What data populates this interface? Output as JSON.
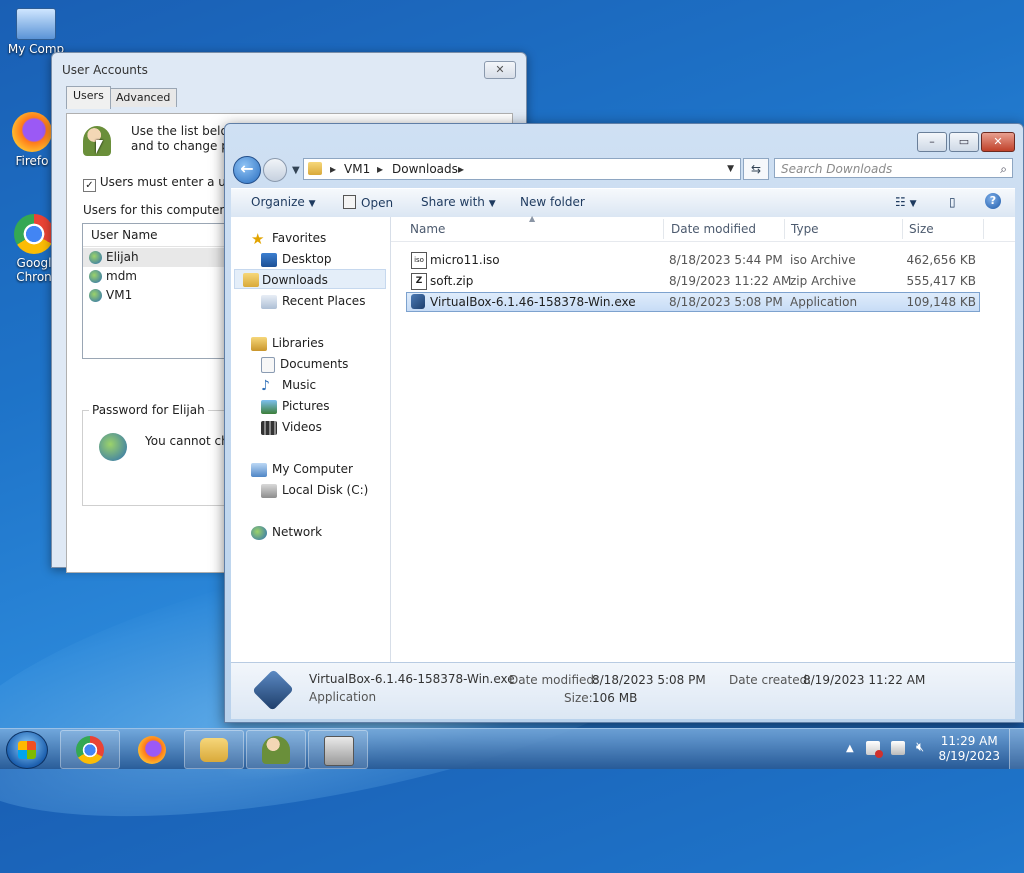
{
  "desktop": {
    "icons": [
      {
        "label": "My Comp",
        "icon": "computer-icon"
      },
      {
        "label": "Firefo",
        "icon": "firefox-icon"
      },
      {
        "label": "Googl",
        "label2": "Chron",
        "icon": "chrome-icon"
      }
    ]
  },
  "user_accounts": {
    "title": "User Accounts",
    "close_glyph": "✕",
    "tabs": [
      "Users",
      "Advanced"
    ],
    "intro_line1": "Use the list below",
    "intro_line2": "and to change pa",
    "checkbox_label": "Users must enter a user n",
    "users_label": "Users for this computer:",
    "column_username": "User Name",
    "users": [
      "Elijah",
      "mdm",
      "VM1"
    ],
    "password_group": "Password for Elijah",
    "password_text": "You cannot cha"
  },
  "explorer": {
    "breadcrumb": [
      "VM1",
      "Downloads"
    ],
    "search_placeholder": "Search Downloads",
    "toolbar": {
      "organize": "Organize",
      "open": "Open",
      "share_with": "Share with",
      "new_folder": "New folder"
    },
    "nav": {
      "favorites": "Favorites",
      "desktop": "Desktop",
      "downloads": "Downloads",
      "recent_places": "Recent Places",
      "libraries": "Libraries",
      "documents": "Documents",
      "music": "Music",
      "pictures": "Pictures",
      "videos": "Videos",
      "my_computer": "My Computer",
      "local_disk": "Local Disk (C:)",
      "network": "Network"
    },
    "columns": {
      "name": "Name",
      "date": "Date modified",
      "type": "Type",
      "size": "Size"
    },
    "files": [
      {
        "name": "micro11.iso",
        "date": "8/18/2023 5:44 PM",
        "type": "iso Archive",
        "size": "462,656 KB"
      },
      {
        "name": "soft.zip",
        "date": "8/19/2023 11:22 AM",
        "type": "zip Archive",
        "size": "555,417 KB"
      },
      {
        "name": "VirtualBox-6.1.46-158378-Win.exe",
        "date": "8/18/2023 5:08 PM",
        "type": "Application",
        "size": "109,148 KB"
      }
    ],
    "details": {
      "filename": "VirtualBox-6.1.46-158378-Win.exe",
      "filetype": "Application",
      "date_modified_label": "Date modified:",
      "date_modified": "8/18/2023 5:08 PM",
      "size_label": "Size:",
      "size": "106 MB",
      "date_created_label": "Date created:",
      "date_created": "8/19/2023 11:22 AM"
    }
  },
  "taskbar": {
    "time": "11:29 AM",
    "date": "8/19/2023"
  }
}
